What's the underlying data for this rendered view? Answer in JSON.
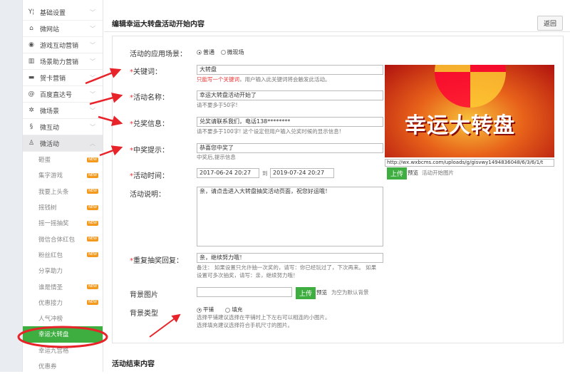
{
  "sidebar": {
    "menus": [
      {
        "icon": "Y¦",
        "label": "基础设置"
      },
      {
        "icon": "⌂",
        "label": "微网站"
      },
      {
        "icon": "◉",
        "label": "游戏互动营销"
      },
      {
        "icon": "▥",
        "label": "场景助力营销"
      },
      {
        "icon": "▬",
        "label": "贺卡营销"
      },
      {
        "icon": "@",
        "label": "百度直达号"
      },
      {
        "icon": "✲",
        "label": "微场景"
      },
      {
        "icon": "§",
        "label": "微互动"
      },
      {
        "icon": "♙",
        "label": "微活动"
      }
    ],
    "sub": [
      {
        "label": "砸蛋",
        "new": "NEW"
      },
      {
        "label": "集字游戏",
        "new": "NEW"
      },
      {
        "label": "我要上头条",
        "new": "NEW"
      },
      {
        "label": "摇钱树",
        "new": "NEW"
      },
      {
        "label": "摇一摇抽奖",
        "new": "NEW"
      },
      {
        "label": "微信合体红包",
        "new": "NEW"
      },
      {
        "label": "粉丝红包",
        "new": "NEW"
      },
      {
        "label": "分享助力"
      },
      {
        "label": "谁是情圣",
        "new": "NEW"
      },
      {
        "label": "优惠接力",
        "new": "NEW"
      },
      {
        "label": "人气冲榜"
      },
      {
        "label": "幸运大转盘"
      },
      {
        "label": "幸运九宫格"
      },
      {
        "label": "优惠券"
      }
    ]
  },
  "header": {
    "title": "编辑幸运大转盘活动开始内容",
    "back": "返回"
  },
  "form": {
    "scene": {
      "label": "活动的应用场景：",
      "opt1": "普通",
      "opt2": "微现场"
    },
    "keyword": {
      "label": "关键词：",
      "value": "大转盘",
      "hint_red": "只能写一个关键词",
      "hint": "，用户输入此关键词将会触发此活动。"
    },
    "name": {
      "label": "活动名称：",
      "value": "幸运大转盘活动开始了",
      "hint": "请不要多于50字!"
    },
    "redeem": {
      "label": "兑奖信息：",
      "value": "兑奖请联系我们，电话138********",
      "hint": "请不要多于100字! 这个设定但用户输入兑奖时候的显示信息!"
    },
    "win": {
      "label": "中奖提示：",
      "value": "恭喜您中奖了",
      "hint": "中奖后,提示信息"
    },
    "time": {
      "label": "活动时间：",
      "start": "2017-06-24 20:27",
      "to": "到",
      "end": "2019-07-24 20:27"
    },
    "desc": {
      "label": "活动说明：",
      "value": "亲，请点击进入大转盘抽奖活动页面，祝您好运哦！"
    },
    "repeat": {
      "label": "重复抽奖回复：",
      "value": "亲，继续努力哦！",
      "hint1": "备注： 如果设置只允许抽一次奖的，请写：你已经玩过了，下次再来。 如果",
      "hint2": "设置可多次抽奖，请写：亲，继续努力哦！"
    },
    "bgimg": {
      "label": "背景图片",
      "value": "",
      "upload": "上传",
      "preview": "预览",
      "hint": "为空为默认背景"
    },
    "bgtype": {
      "label": "背景类型",
      "opt1": "平铺",
      "opt2": "填充",
      "hint1": "选择平铺建议选择在平铺时上下左右可以相连的小图片。",
      "hint2": "选择填充建议选择符合手机尺寸的图片。"
    },
    "image": {
      "banner_text": "幸运大转盘",
      "url": "http://wx.wxbcms.com/uploads/g/gisvwy1494836048/6/3/6/1/t",
      "upload": "上传",
      "preview": "预览",
      "caption": "活动开始图片"
    }
  },
  "end_title": "活动结束内容",
  "colors": {
    "accent": "#3dae3f",
    "annotation": "#e8232a"
  }
}
